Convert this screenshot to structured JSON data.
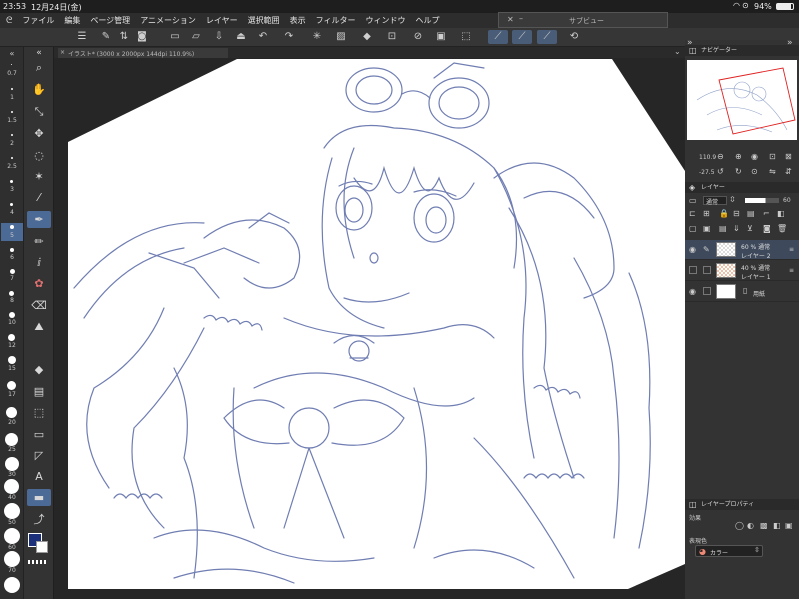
{
  "status": {
    "time": "23:53",
    "date": "12月24日(金)",
    "battery": "94%"
  },
  "menu": [
    "ファイル",
    "編集",
    "ページ管理",
    "アニメーション",
    "レイヤー",
    "選択範囲",
    "表示",
    "フィルター",
    "ウィンドウ",
    "ヘルプ"
  ],
  "subview": {
    "title": "サブビュー"
  },
  "canvas_tab": {
    "title": "イラスト* (3000 x 2000px 144dpi 110.9%)"
  },
  "brush_sizes": [
    "0.7",
    "1",
    "1.5",
    "2",
    "2.5",
    "3",
    "4",
    "5",
    "6",
    "7",
    "8",
    "10",
    "12",
    "15",
    "17",
    "20",
    "25",
    "30",
    "40",
    "50",
    "60",
    "70"
  ],
  "navigator": {
    "title": "ナビゲーター",
    "zoom": "110.9",
    "rotation": "-27.5"
  },
  "layers_panel": {
    "title": "レイヤー",
    "blend_mode": "通常",
    "opacity": "60",
    "layers": [
      {
        "pct": "60 % 通常",
        "name": "レイヤー 2",
        "selected": true
      },
      {
        "pct": "40 % 通常",
        "name": "レイヤー 1",
        "selected": false
      },
      {
        "pct": "",
        "name": "用紙",
        "selected": false
      }
    ]
  },
  "layer_props": {
    "title": "レイヤープロパティ",
    "effect_label": "効果",
    "display_color_label": "表現色",
    "display_color_value": "カラー"
  },
  "colors": {
    "line": "#6f7db2",
    "accent": "#4c6a96",
    "main_color": "#1c2f7a"
  }
}
